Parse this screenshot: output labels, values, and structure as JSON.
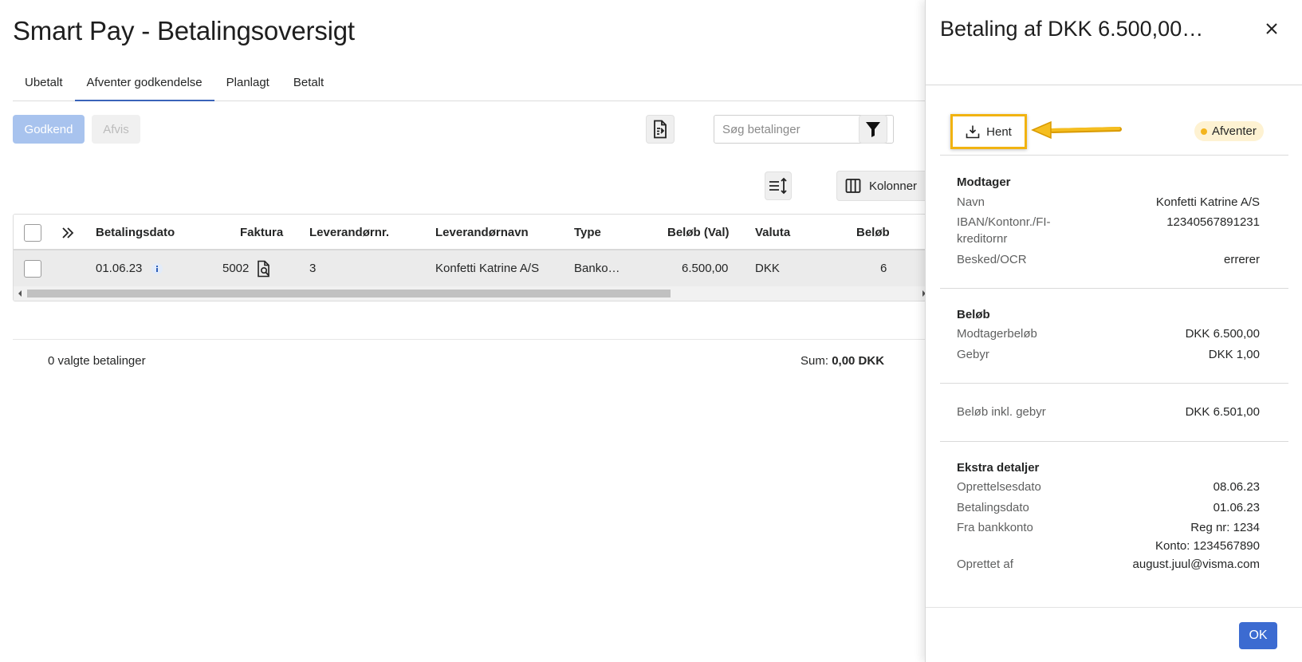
{
  "page": {
    "title": "Smart Pay - Betalingsoversigt"
  },
  "tabs": [
    {
      "label": "Ubetalt"
    },
    {
      "label": "Afventer godkendelse"
    },
    {
      "label": "Planlagt"
    },
    {
      "label": "Betalt"
    }
  ],
  "toolbar": {
    "approve_label": "Godkend",
    "reject_label": "Afvis",
    "search_placeholder": "Søg betalinger",
    "columns_label": "Kolonner"
  },
  "grid": {
    "headers": {
      "date": "Betalingsdato",
      "invoice": "Faktura",
      "supplier_no": "Leverandørnr.",
      "supplier_name": "Leverandørnavn",
      "type": "Type",
      "amount": "Beløb (Val)",
      "currency": "Valuta",
      "amount2": "Beløb"
    },
    "rows": [
      {
        "date": "01.06.23",
        "invoice": "5002",
        "supplier_no": "3",
        "supplier_name": "Konfetti Katrine A/S",
        "type": "Banko…",
        "amount": "6.500,00",
        "currency": "DKK",
        "amount2": "6"
      }
    ]
  },
  "footer": {
    "selected": "0 valgte betalinger",
    "sum_label": "Sum:",
    "sum_value": "0,00 DKK"
  },
  "panel": {
    "title": "Betaling af DKK 6.500,00…",
    "download_label": "Hent",
    "status": "Afventer",
    "recipient": {
      "title": "Modtager",
      "name_label": "Navn",
      "name_value": "Konfetti Katrine A/S",
      "iban_label": "IBAN/Kontonr./FI-kreditornr",
      "iban_value": "12340567891231",
      "message_label": "Besked/OCR",
      "message_value": "errerer"
    },
    "amount": {
      "title": "Beløb",
      "recipient_amount_label": "Modtagerbeløb",
      "recipient_amount_value": "DKK 6.500,00",
      "fee_label": "Gebyr",
      "fee_value": "DKK 1,00"
    },
    "total": {
      "label": "Beløb inkl. gebyr",
      "value": "DKK 6.501,00"
    },
    "extra": {
      "title": "Ekstra detaljer",
      "created_label": "Oprettelsesdato",
      "created_value": "08.06.23",
      "paydate_label": "Betalingsdato",
      "paydate_value": "01.06.23",
      "account_label": "Fra bankkonto",
      "account_reg": "Reg nr: 1234",
      "account_no": "Konto: 1234567890",
      "creator_label": "Oprettet af",
      "creator_value": "august.juul@visma.com"
    },
    "ok_label": "OK"
  },
  "colors": {
    "primary": "#3c6bd1",
    "primary_disabled": "#a8c3ee",
    "tab_active": "#3a64b9",
    "highlight": "#f1b311",
    "status_bg": "#fef2d2",
    "status_dot": "#f3b41c"
  }
}
